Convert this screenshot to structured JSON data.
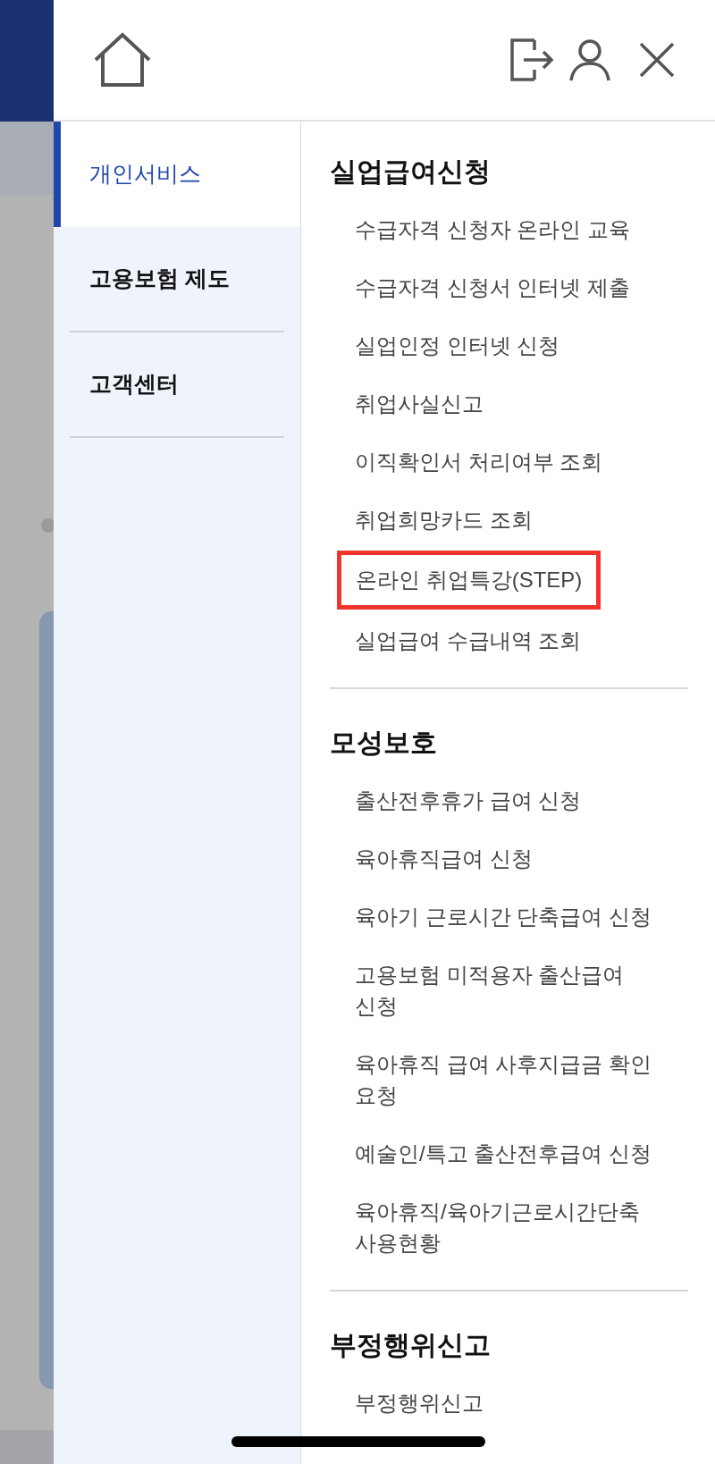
{
  "nav_tabs": [
    {
      "label": "개인서비스",
      "selected": true
    },
    {
      "label": "고용보험 제도",
      "selected": false
    },
    {
      "label": "고객센터",
      "selected": false
    }
  ],
  "sections": [
    {
      "title": "실업급여신청",
      "items": [
        {
          "label": "수급자격 신청자 온라인 교육",
          "highlighted": false
        },
        {
          "label": "수급자격 신청서 인터넷 제출",
          "highlighted": false
        },
        {
          "label": "실업인정 인터넷 신청",
          "highlighted": false
        },
        {
          "label": "취업사실신고",
          "highlighted": false
        },
        {
          "label": "이직확인서 처리여부 조회",
          "highlighted": false
        },
        {
          "label": "취업희망카드 조회",
          "highlighted": false
        },
        {
          "label": "온라인 취업특강(STEP)",
          "highlighted": true
        },
        {
          "label": "실업급여 수급내역 조회",
          "highlighted": false
        }
      ]
    },
    {
      "title": "모성보호",
      "items": [
        {
          "label": "출산전후휴가 급여 신청",
          "highlighted": false
        },
        {
          "label": "육아휴직급여 신청",
          "highlighted": false
        },
        {
          "label": "육아기 근로시간 단축급여 신청",
          "highlighted": false
        },
        {
          "label": "고용보험 미적용자 출산급여 신청",
          "highlighted": false
        },
        {
          "label": "육아휴직 급여 사후지급금 확인 요청",
          "highlighted": false
        },
        {
          "label": "예술인/특고 출산전후급여 신청",
          "highlighted": false
        },
        {
          "label": "육아휴직/육아기근로시간단축 사용현황",
          "highlighted": false
        }
      ]
    },
    {
      "title": "부정행위신고",
      "items": [
        {
          "label": "부정행위신고",
          "highlighted": false
        }
      ]
    }
  ]
}
